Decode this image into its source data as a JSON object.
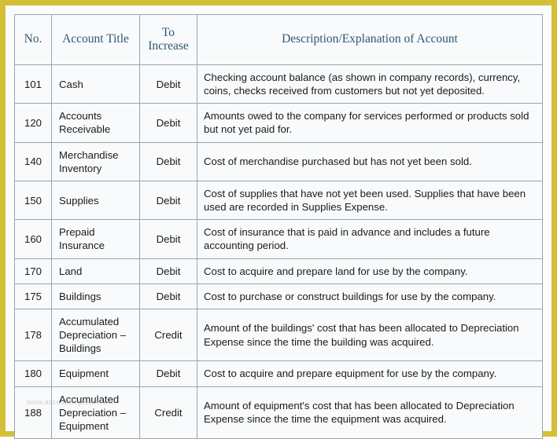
{
  "frame": {
    "border_color": "#d4bf36",
    "page_background": "#fafcfd"
  },
  "table": {
    "background": "#f8fafb",
    "grid_color": "#9aa6ab",
    "header_text_color": "#2d5871",
    "body_text_color": "#1b1b1b",
    "columns": [
      {
        "key": "no",
        "label": "No."
      },
      {
        "key": "title",
        "label": "Account Title"
      },
      {
        "key": "incr",
        "label": "To\nIncrease"
      },
      {
        "key": "desc",
        "label": "Description/Explanation of Account"
      }
    ],
    "header": {
      "no": "No.",
      "title": "Account Title",
      "incr_line1": "To",
      "incr_line2": "Increase",
      "desc": "Description/Explanation of Account"
    },
    "rows": [
      {
        "no": "101",
        "title": "Cash",
        "incr": "Debit",
        "desc": "Checking account balance (as shown in company records), currency, coins, checks received from customers but not yet deposited."
      },
      {
        "no": "120",
        "title": "Accounts Receivable",
        "incr": "Debit",
        "desc": "Amounts owed to the company for services performed or products sold but not yet paid for."
      },
      {
        "no": "140",
        "title": "Merchandise Inventory",
        "incr": "Debit",
        "desc": "Cost of merchandise purchased but has not yet been sold."
      },
      {
        "no": "150",
        "title": "Supplies",
        "incr": "Debit",
        "desc": "Cost of supplies that have not yet been used. Supplies that have been used are recorded in Supplies Expense."
      },
      {
        "no": "160",
        "title": "Prepaid Insurance",
        "incr": "Debit",
        "desc": "Cost of insurance that is paid in advance and includes a future accounting period."
      },
      {
        "no": "170",
        "title": "Land",
        "incr": "Debit",
        "desc": "Cost to acquire and prepare land for use by the company."
      },
      {
        "no": "175",
        "title": "Buildings",
        "incr": "Debit",
        "desc": "Cost to purchase or construct buildings for use by the company."
      },
      {
        "no": "178",
        "title": "Accumulated Depreciation – Buildings",
        "incr": "Credit",
        "desc": "Amount of the buildings' cost that has been allocated to Depreciation Expense since the time the building was acquired."
      },
      {
        "no": "180",
        "title": "Equipment",
        "incr": "Debit",
        "desc": "Cost to acquire and prepare equipment for use by the company."
      },
      {
        "no": "188",
        "title": "Accumulated Depreciation – Equipment",
        "incr": "Credit",
        "desc": "Amount of equipment's cost that has been allocated to Depreciation Expense since the time the equipment was acquired."
      }
    ]
  },
  "watermark": {
    "text": "www.accountingcoach.com"
  }
}
